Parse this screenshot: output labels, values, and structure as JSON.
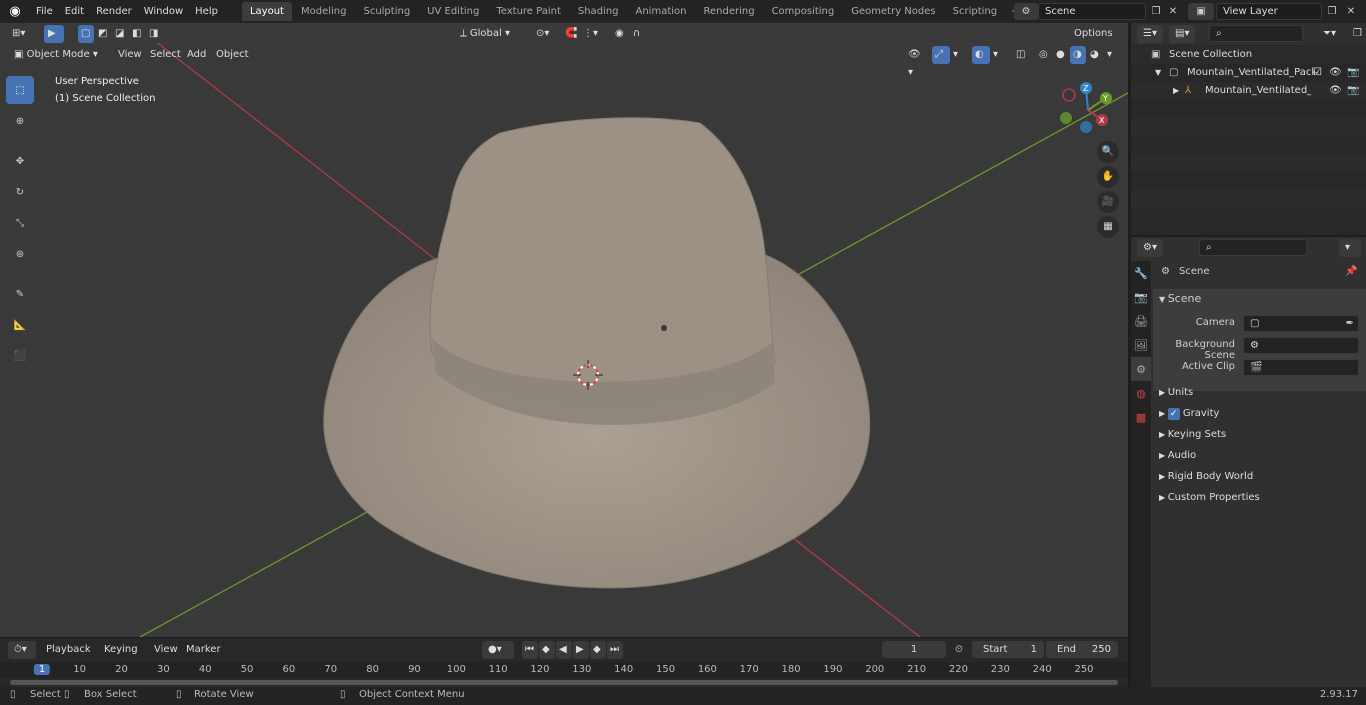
{
  "menus": [
    "File",
    "Edit",
    "Render",
    "Window",
    "Help"
  ],
  "workspaces": [
    "Layout",
    "Modeling",
    "Sculpting",
    "UV Editing",
    "Texture Paint",
    "Shading",
    "Animation",
    "Rendering",
    "Compositing",
    "Geometry Nodes",
    "Scripting"
  ],
  "scene_field": "Scene",
  "view_layer_field": "View Layer",
  "header": {
    "mode": "Object Mode",
    "view": "View",
    "select": "Select",
    "add": "Add",
    "object": "Object",
    "orientation": "Global",
    "options": "Options"
  },
  "viewport": {
    "perspective": "User Perspective",
    "collection": "(1) Scene Collection",
    "gizmo": {
      "x": "X",
      "y": "Y",
      "z": "Z"
    }
  },
  "outliner": {
    "root": "Scene Collection",
    "item1": "Mountain_Ventilated_Packer_",
    "item2": "Mountain_Ventilated_Pac"
  },
  "properties": {
    "context": "Scene",
    "panel": "Scene",
    "camera_label": "Camera",
    "bg_scene_label": "Background Scene",
    "active_clip_label": "Active Clip",
    "sections": [
      "Units",
      "Gravity",
      "Keying Sets",
      "Audio",
      "Rigid Body World",
      "Custom Properties"
    ]
  },
  "timeline": {
    "playback": "Playback",
    "keying": "Keying",
    "view": "View",
    "marker": "Marker",
    "current_frame": "1",
    "start_label": "Start",
    "start": "1",
    "end_label": "End",
    "end": "250",
    "ticks": [
      "1",
      "10",
      "20",
      "30",
      "40",
      "50",
      "60",
      "70",
      "80",
      "90",
      "100",
      "110",
      "120",
      "130",
      "140",
      "150",
      "160",
      "170",
      "180",
      "190",
      "200",
      "210",
      "220",
      "230",
      "240",
      "250"
    ]
  },
  "status": {
    "select": "Select",
    "box_select": "Box Select",
    "rotate": "Rotate View",
    "context_menu": "Object Context Menu",
    "version": "2.93.17"
  },
  "colors": {
    "accent": "#4772b3",
    "x_axis": "#b03a48",
    "y_axis": "#6a9a2a",
    "z_axis": "#2f83c9",
    "hat": "#a59a8e"
  }
}
